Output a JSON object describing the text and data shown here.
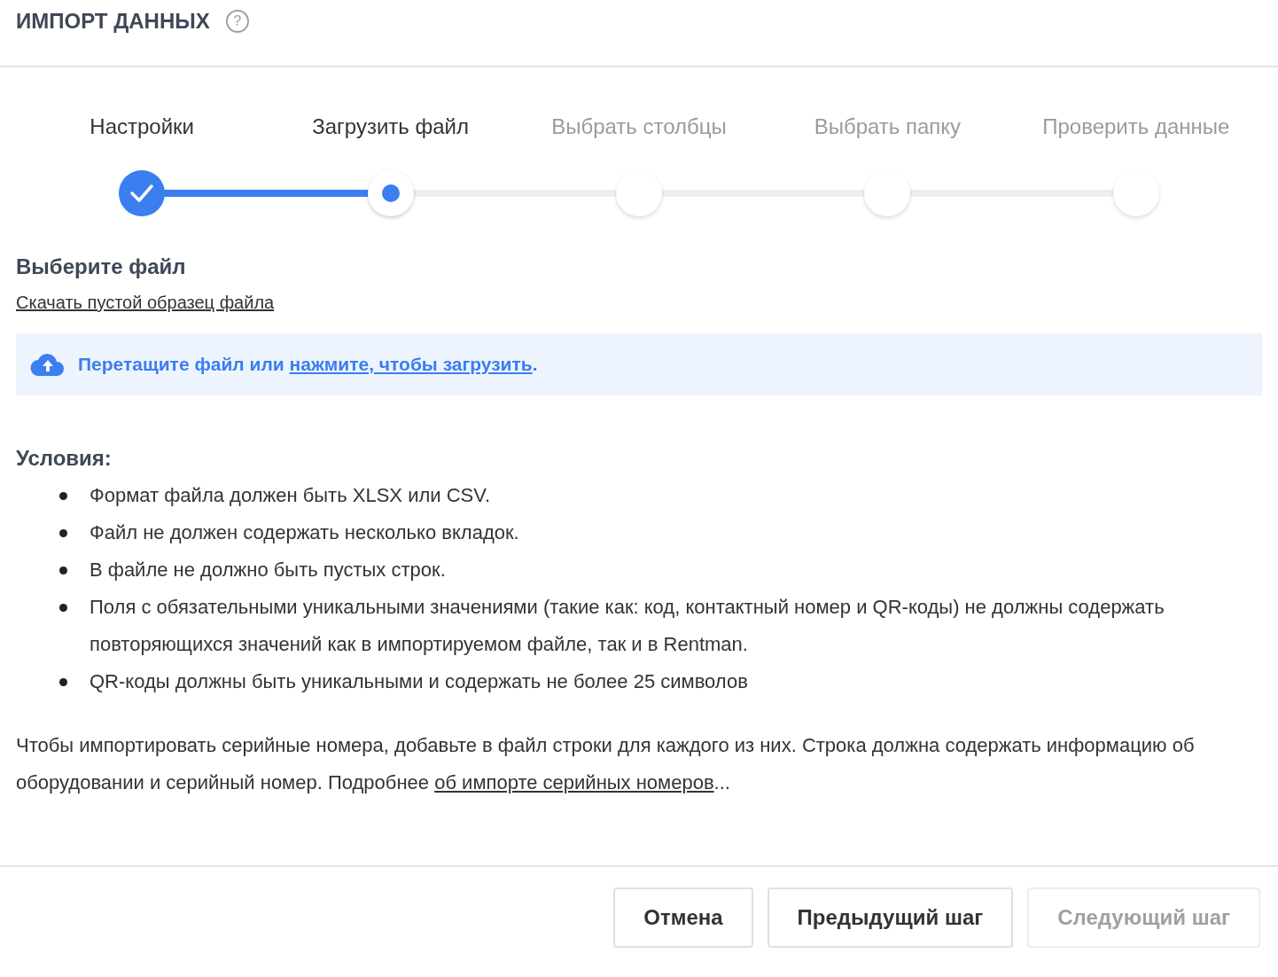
{
  "header": {
    "title": "ИМПОРТ ДАННЫХ",
    "help": "?"
  },
  "steps": [
    {
      "label": "Настройки",
      "kind": "done"
    },
    {
      "label": "Загрузить файл",
      "kind": "current"
    },
    {
      "label": "Выбрать столбцы",
      "kind": "pending"
    },
    {
      "label": "Выбрать папку",
      "kind": "pending"
    },
    {
      "label": "Проверить данные",
      "kind": "pending"
    }
  ],
  "file_section": {
    "heading": "Выберите файл",
    "sample_link": "Скачать пустой образец файла"
  },
  "dropzone": {
    "text_before": "Перетащите файл или ",
    "link": "нажмите, чтобы загрузить",
    "text_after": "."
  },
  "conditions": {
    "heading": "Условия:",
    "items": [
      "Формат файла должен быть XLSX или CSV.",
      "Файл не должен содержать несколько вкладок.",
      "В файле не должно быть пустых строк.",
      "Поля с обязательными уникальными значениями (такие как: код, контактный номер и QR-коды) не должны содержать повторяющихся значений как в импортируемом файле, так и в Rentman.",
      "QR-коды должны быть уникальными и содержать не более 25 символов"
    ]
  },
  "note": {
    "text_before": "Чтобы импортировать серийные номера, добавьте в файл строки для каждого из них. Строка должна содержать информацию об оборудовании и серийный номер. Подробнее ",
    "link": "об импорте серийных номеров",
    "text_after": "..."
  },
  "buttons": [
    {
      "label": "Отмена",
      "disabled": false
    },
    {
      "label": "Предыдущий шаг",
      "disabled": false
    },
    {
      "label": "Следующий шаг",
      "disabled": true
    }
  ]
}
